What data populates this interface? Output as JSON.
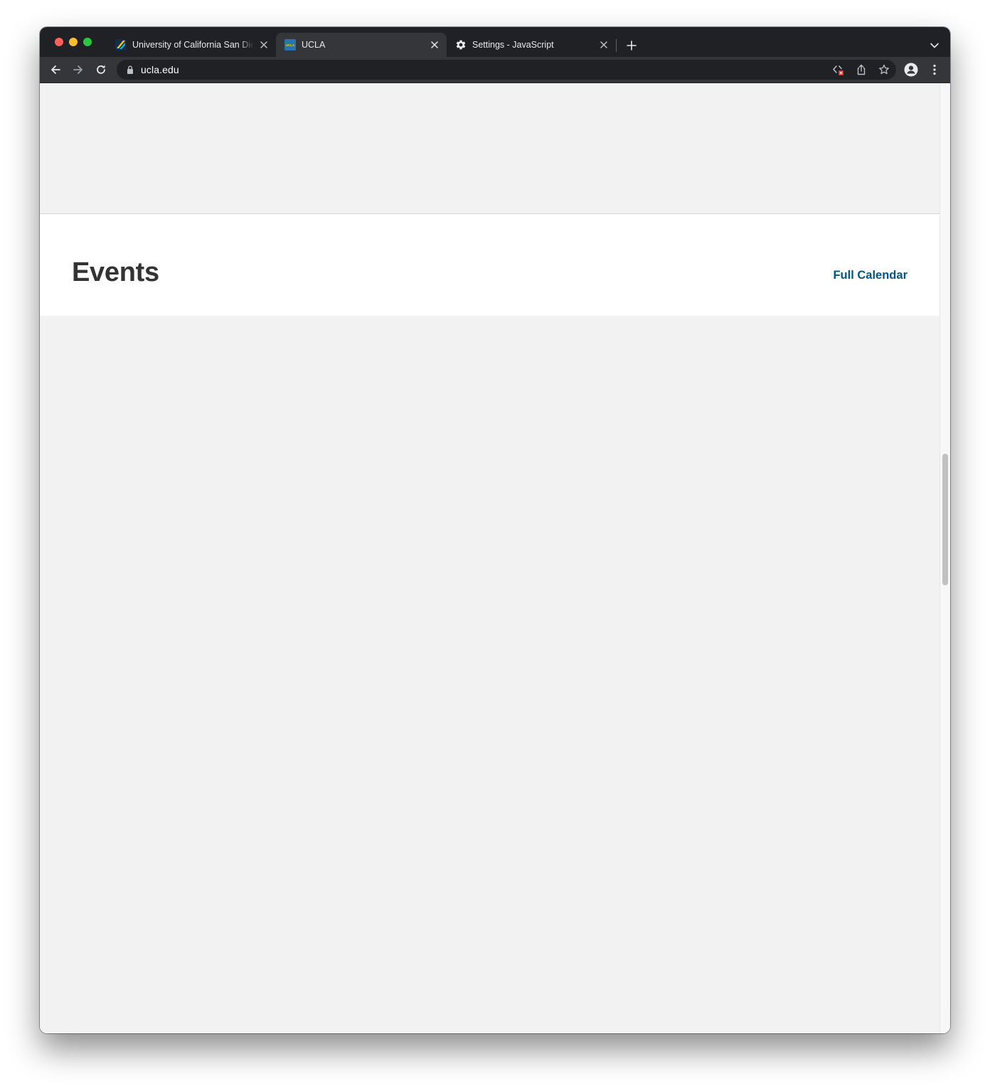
{
  "browser": {
    "tabs": [
      {
        "title": "University of California San Diego",
        "favicon": "ucsd-favicon",
        "active": false
      },
      {
        "title": "UCLA",
        "favicon": "ucla-favicon",
        "active": true
      },
      {
        "title": "Settings - JavaScript",
        "favicon": "gear-icon",
        "active": false
      }
    ],
    "ucla_favicon_text": "UCLA",
    "address_bar": {
      "url": "ucla.edu"
    }
  },
  "page": {
    "events_heading": "Events",
    "full_calendar_link": "Full Calendar"
  },
  "colors": {
    "link": "#005587",
    "heading": "#333333",
    "page_background": "#f2f2f2",
    "ucla_blue": "#2774ae"
  },
  "scroll_position_fraction": 0.46
}
